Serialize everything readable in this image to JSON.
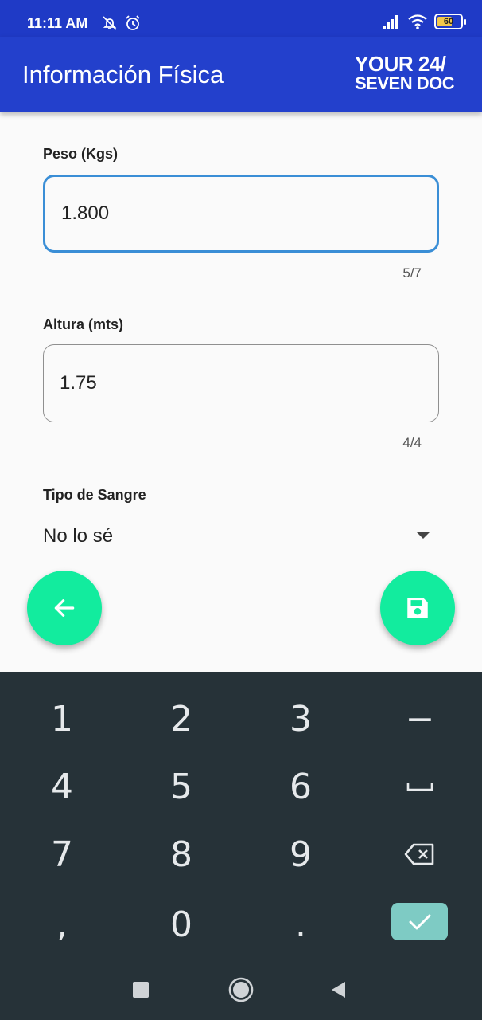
{
  "status_bar": {
    "time": "11:11 AM",
    "battery_level": "60",
    "icons": [
      "notifications-off-icon",
      "alarm-icon",
      "signal-icon",
      "wifi-icon",
      "battery-icon"
    ]
  },
  "app_bar": {
    "title": "Información Física",
    "logo_line1": "YOUR 24/",
    "logo_line2": "SEVEN DOC",
    "color": "#2340cc"
  },
  "form": {
    "weight": {
      "label": "Peso (Kgs)",
      "value": "1.800",
      "counter": "5/7"
    },
    "height": {
      "label": "Altura (mts)",
      "value": "1.75",
      "counter": "4/4"
    },
    "blood_type": {
      "label": "Tipo de Sangre",
      "value": "No lo sé"
    }
  },
  "actions": {
    "back_icon": "arrow-left-icon",
    "save_icon": "save-icon",
    "accent": "#12ec9e"
  },
  "keyboard": {
    "rows": [
      [
        "1",
        "2",
        "3",
        "−"
      ],
      [
        "4",
        "5",
        "6",
        "␣"
      ],
      [
        "7",
        "8",
        "9",
        "⌫"
      ],
      [
        ",",
        "0",
        ".",
        "✓"
      ]
    ],
    "background": "#263238"
  }
}
